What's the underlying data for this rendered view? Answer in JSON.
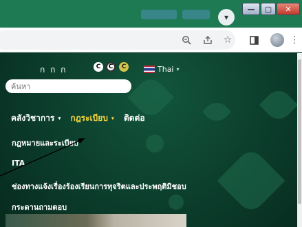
{
  "titlebar": {
    "dropdown_icon": "chevron-down-icon",
    "minimize_label": "—",
    "maximize_label": "▢",
    "close_label": "✕"
  },
  "toolbar": {
    "icons": [
      "zoom-icon",
      "share-icon",
      "star-icon",
      "sidebar-icon",
      "profile-avatar",
      "menu-dots-icon"
    ]
  },
  "page": {
    "top_links": "ก ก ก",
    "contrast_buttons": [
      "C",
      "C",
      "C"
    ],
    "language": "Thai",
    "search_placeholder": "ค้นหา",
    "nav": [
      {
        "label": "คลังวิชาการ",
        "active": false
      },
      {
        "label": "กฎระเบียบ",
        "active": true
      },
      {
        "label": "ติดต่อ",
        "active": false
      }
    ],
    "menu_items": [
      "กฎหมายและระเบียบ",
      "ITA",
      "ช่องทางแจ้งเรื่องร้องเรียนการทุจริตและประพฤติมิชอบ",
      "กระดานถามตอบ"
    ]
  },
  "colors": {
    "page_bg": "#0b3b2a",
    "accent_yellow": "#f6d53b",
    "titlebar": "#1d7a52"
  }
}
